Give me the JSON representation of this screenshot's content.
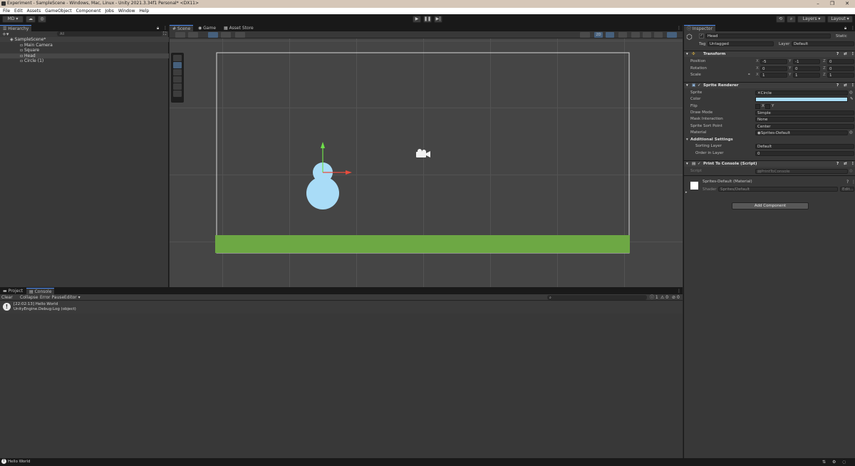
{
  "window": {
    "title": "Experiment - SampleScene - Windows, Mac, Linux - Unity 2021.3.34f1 Personal* <DX11>",
    "controls": [
      "–",
      "❐",
      "✕"
    ]
  },
  "menu": [
    "File",
    "Edit",
    "Assets",
    "GameObject",
    "Component",
    "Jobs",
    "Window",
    "Help"
  ],
  "toolbar": {
    "account": "MD ▾",
    "play_icons": [
      "play-icon",
      "pause-icon",
      "step-icon"
    ],
    "layers_label": "Layers",
    "layout_label": "Layout"
  },
  "hierarchy": {
    "tab": "Hierarchy",
    "search_placeholder": "All",
    "scene_name": "SampleScene*",
    "items": [
      "Main Camera",
      "Square",
      "Head",
      "Circle (1)"
    ]
  },
  "scene_tabs": [
    "Scene",
    "Game",
    "Asset Store"
  ],
  "scene_toolbar": {
    "mode_2d": "2D"
  },
  "scene_colors": {
    "ground": "#6da844",
    "head": "#a9dcf7",
    "body": "#a9dcf7",
    "gizmo_y": "#6fe04a",
    "gizmo_x": "#e84c3d",
    "camera_frame": "#d8d8d8"
  },
  "inspector": {
    "tab": "Inspector",
    "object_name": "Head",
    "static_label": "Static",
    "tag_label": "Tag",
    "tag_value": "Untagged",
    "layer_label": "Layer",
    "layer_value": "Default",
    "transform": {
      "title": "Transform",
      "position": {
        "label": "Position",
        "x": "-5",
        "y": "-1",
        "z": "0"
      },
      "rotation": {
        "label": "Rotation",
        "x": "0",
        "y": "0",
        "z": "0"
      },
      "scale": {
        "label": "Scale",
        "x": "1",
        "y": "1",
        "z": "1"
      }
    },
    "sprite_renderer": {
      "title": "Sprite Renderer",
      "sprite_label": "Sprite",
      "sprite_value": "Circle",
      "color_label": "Color",
      "color_value": "#a9dcf7",
      "flip_label": "Flip",
      "flip_x": "X",
      "flip_y": "Y",
      "draw_mode_label": "Draw Mode",
      "draw_mode_value": "Simple",
      "mask_label": "Mask Interaction",
      "mask_value": "None",
      "sort_point_label": "Sprite Sort Point",
      "sort_point_value": "Center",
      "material_label": "Material",
      "material_value": "Sprites-Default",
      "additional_label": "Additional Settings",
      "sorting_layer_label": "Sorting Layer",
      "sorting_layer_value": "Default",
      "order_label": "Order in Layer",
      "order_value": "0"
    },
    "script": {
      "title": "Print To Console (Script)",
      "script_label": "Script",
      "script_value": "PrintToConsole"
    },
    "material": {
      "name": "Sprites-Default (Material)",
      "shader_label": "Shader",
      "shader_value": "Sprites/Default",
      "edit_label": "Edit..."
    },
    "add_component": "Add Component"
  },
  "console": {
    "tabs": [
      "Project",
      "Console"
    ],
    "buttons": [
      "Clear",
      "Collapse",
      "Error Pause",
      "Editor ▾"
    ],
    "counts": {
      "log": "1",
      "warn": "0",
      "error": "0"
    },
    "entry_line1": "[22:02:13] Hello World",
    "entry_line2": "UnityEngine.Debug:Log (object)"
  },
  "status": {
    "text": "Hello World"
  }
}
